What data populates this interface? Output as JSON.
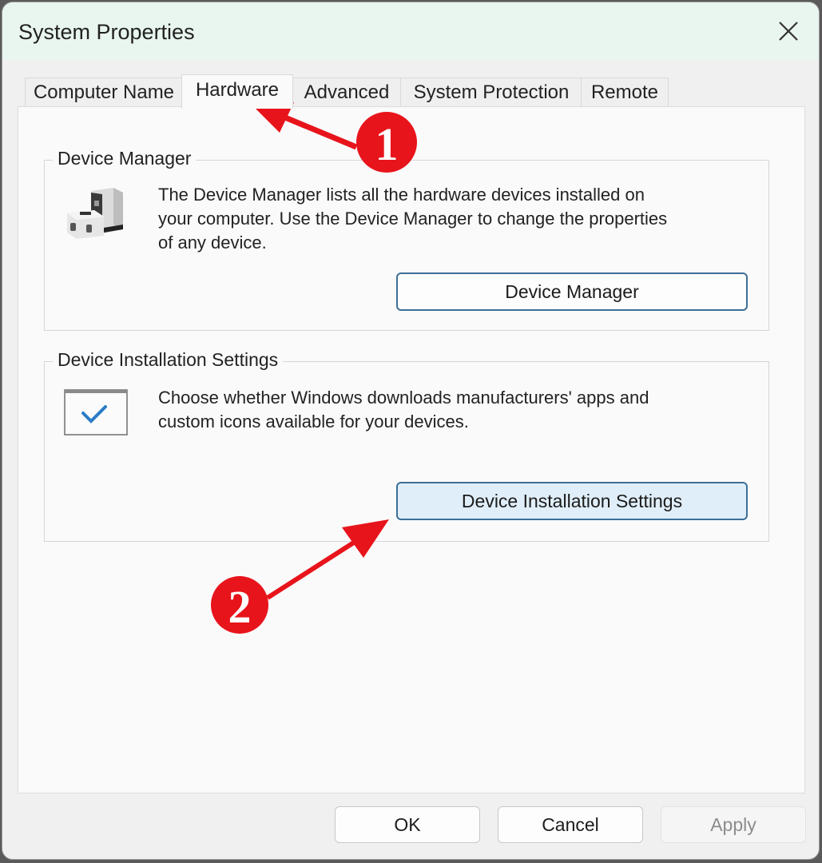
{
  "window": {
    "title": "System Properties",
    "close_icon": "close-icon"
  },
  "tabs": [
    {
      "label": "Computer Name",
      "active": false
    },
    {
      "label": "Hardware",
      "active": true
    },
    {
      "label": "Advanced",
      "active": false
    },
    {
      "label": "System Protection",
      "active": false
    },
    {
      "label": "Remote",
      "active": false
    }
  ],
  "device_manager": {
    "group_label": "Device Manager",
    "icon": "device-manager-icon",
    "description_lines": [
      "The Device Manager lists all the hardware devices installed on",
      "your computer. Use the Device Manager to change the properties",
      "of any device."
    ],
    "button_label": "Device Manager"
  },
  "device_installation": {
    "group_label": "Device Installation Settings",
    "icon": "window-checkmark-icon",
    "description_lines": [
      "Choose whether Windows downloads manufacturers' apps and",
      "custom icons available for your devices."
    ],
    "button_label": "Device Installation Settings"
  },
  "footer": {
    "ok_label": "OK",
    "cancel_label": "Cancel",
    "apply_label": "Apply",
    "apply_enabled": false
  },
  "annotations": [
    {
      "number": "1",
      "target": "Hardware tab"
    },
    {
      "number": "2",
      "target": "Device Installation Settings button"
    }
  ],
  "colors": {
    "annotation_red": "#e8141b",
    "titlebar_bg": "#e8f6ef",
    "accent_border": "#3c6f97",
    "hover_button_bg": "#e0eef9",
    "check_blue": "#2a7cc7"
  }
}
